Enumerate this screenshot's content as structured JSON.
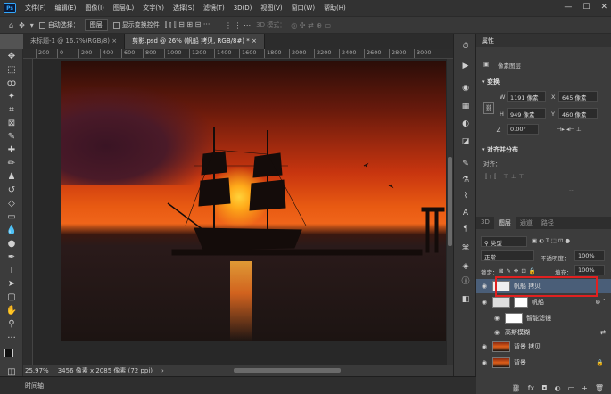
{
  "app": {
    "logo": "Ps"
  },
  "menu": [
    "文件(F)",
    "编辑(E)",
    "图像(I)",
    "图层(L)",
    "文字(Y)",
    "选择(S)",
    "滤镜(T)",
    "3D(D)",
    "视图(V)",
    "窗口(W)",
    "帮助(H)"
  ],
  "window_controls": {
    "minimize": "—",
    "maximize": "☐",
    "close": "✕"
  },
  "options": {
    "auto_select_label": "自动选择：",
    "auto_select_value": "图层",
    "show_transform_label": "显示变换控件",
    "mode_3d_label": "3D 模式："
  },
  "tabs": [
    {
      "label": "未标题-1 @ 16.7%(RGB/8)",
      "close": "×"
    },
    {
      "label": "剪影.psd @ 26% (帆船 拷贝, RGB/8#) *",
      "close": "×"
    }
  ],
  "ruler_ticks": [
    "200",
    "0",
    "200",
    "400",
    "600",
    "800",
    "1000",
    "1200",
    "1400",
    "1600",
    "1800",
    "2000",
    "2200",
    "2400",
    "2600",
    "2800",
    "3000",
    "3200",
    "3400",
    "3600"
  ],
  "status": {
    "zoom": "25.97%",
    "doc_info": "3456 像素 x 2085 像素 (72 ppi)",
    "arrow": "›"
  },
  "timeline_label": "时间轴",
  "properties": {
    "header": "属性",
    "kind": "像素图层",
    "transform_title": "变换",
    "w_label": "W",
    "w_value": "1191 像素",
    "x_label": "X",
    "x_value": "645 像素",
    "h_label": "H",
    "h_value": "949 像素",
    "y_label": "Y",
    "y_value": "460 像素",
    "angle_value": "0.00°",
    "align_title": "对齐并分布",
    "align_label": "对齐："
  },
  "layers_panel": {
    "tabs": [
      "3D",
      "图层",
      "通道",
      "路径"
    ],
    "filter_value": "类型",
    "blend_value": "正常",
    "opacity_label": "不透明度：",
    "opacity_value": "100%",
    "lock_label": "锁定：",
    "fill_label": "填充：",
    "fill_value": "100%",
    "layers": [
      {
        "name": "帆船 拷贝"
      },
      {
        "name": "帆船"
      },
      {
        "name": "智能滤镜"
      },
      {
        "name": "高斯模糊"
      },
      {
        "name": "背景 拷贝"
      },
      {
        "name": "背景"
      }
    ],
    "footer_icons": [
      "⛓",
      "fx",
      "◘",
      "◐",
      "▭",
      "+",
      "🗑"
    ]
  }
}
